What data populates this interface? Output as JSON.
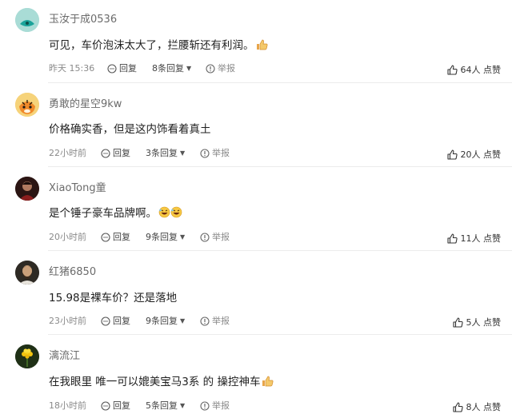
{
  "comments": [
    {
      "username": "玉汝于成0536",
      "text": "可见，车价泡沫太大了，拦腰斩还有利润。",
      "time": "昨天 15:36",
      "reply_label": "回复",
      "replies": "8条回复",
      "report_label": "举报",
      "likes": "64人 点赞",
      "avatar": "teal-blob-avatar",
      "emoji": "thumbs-up-emoji"
    },
    {
      "username": "勇敢的星空9kw",
      "text": "价格确实香，但是这内饰看着真土",
      "time": "22小时前",
      "reply_label": "回复",
      "replies": "3条回复",
      "report_label": "举报",
      "likes": "20人 点赞",
      "avatar": "tiger-avatar"
    },
    {
      "username": "XiaoTong童",
      "text": "是个锤子豪车品牌啊。",
      "time": "20小时前",
      "reply_label": "回复",
      "replies": "9条回复",
      "report_label": "举报",
      "likes": "11人 点赞",
      "avatar": "dark-portrait-avatar",
      "emoji": "laughing-emoji"
    },
    {
      "username": "红猪6850",
      "text": "15.98是裸车价？还是落地",
      "time": "23小时前",
      "reply_label": "回复",
      "replies": "9条回复",
      "report_label": "举报",
      "likes": "5人 点赞",
      "avatar": "bearded-man-avatar"
    },
    {
      "username": "漓流江",
      "text": "在我眼里 唯一可以媲美宝马3系 的 操控神车",
      "time": "18小时前",
      "reply_label": "回复",
      "replies": "5条回复",
      "report_label": "举报",
      "likes": "8人 点赞",
      "avatar": "yellow-flower-avatar",
      "emoji": "thumbs-up-emoji"
    }
  ]
}
